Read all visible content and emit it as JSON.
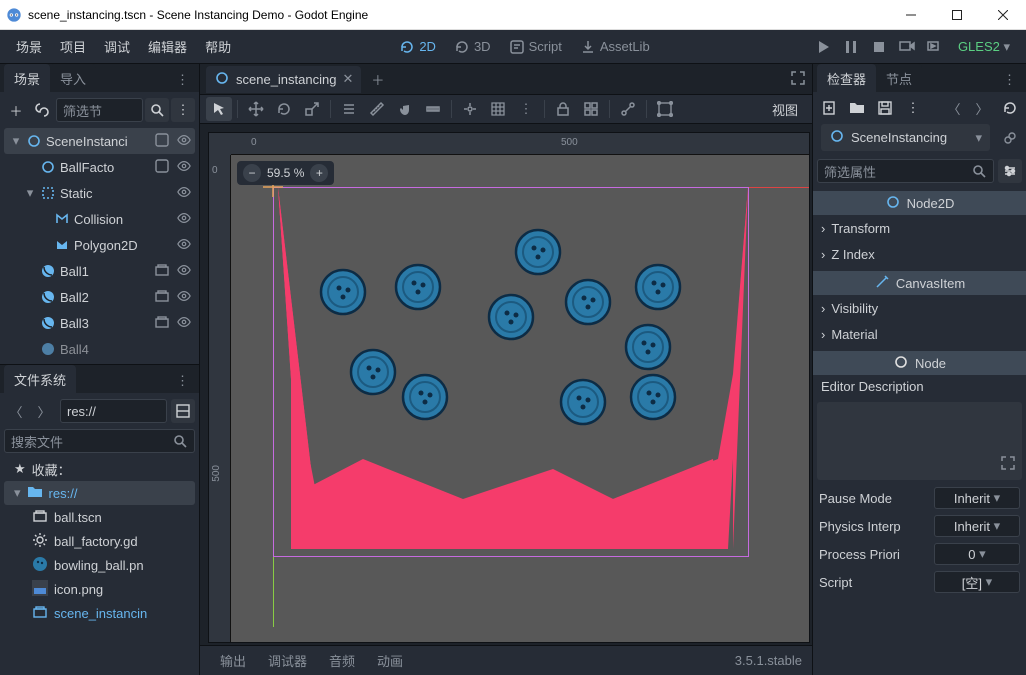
{
  "window": {
    "title": "scene_instancing.tscn - Scene Instancing Demo - Godot Engine"
  },
  "menu": {
    "items": [
      "场景",
      "项目",
      "调试",
      "编辑器",
      "帮助"
    ],
    "workspaces": {
      "ws2d": "2D",
      "ws3d": "3D",
      "script": "Script",
      "assetlib": "AssetLib"
    },
    "renderer": "GLES2"
  },
  "scene_dock": {
    "tabs": {
      "scene": "场景",
      "import": "导入"
    },
    "filter_placeholder": "筛选节",
    "tree": [
      {
        "name": "SceneInstanci",
        "type": "Node2D",
        "depth": 0,
        "expanded": true,
        "selected": true,
        "script": true,
        "vis": true
      },
      {
        "name": "BallFacto",
        "type": "Node2D",
        "depth": 1,
        "script": true,
        "vis": true
      },
      {
        "name": "Static",
        "type": "StaticBody2D",
        "depth": 1,
        "expanded": true,
        "vis": true
      },
      {
        "name": "Collision",
        "type": "CollisionPolygon2D",
        "depth": 2,
        "vis": true
      },
      {
        "name": "Polygon2D",
        "type": "Polygon2D",
        "depth": 2,
        "vis": true
      },
      {
        "name": "Ball1",
        "type": "RigidBody2D",
        "depth": 1,
        "inst": true,
        "vis": true
      },
      {
        "name": "Ball2",
        "type": "RigidBody2D",
        "depth": 1,
        "inst": true,
        "vis": true
      },
      {
        "name": "Ball3",
        "type": "RigidBody2D",
        "depth": 1,
        "inst": true,
        "vis": true
      },
      {
        "name": "Ball4",
        "type": "RigidBody2D",
        "depth": 1,
        "inst": true,
        "vis": true
      }
    ]
  },
  "filesystem": {
    "title": "文件系统",
    "path": "res://",
    "search_placeholder": "搜索文件",
    "fav_label": "收藏：",
    "root": "res://",
    "files": [
      {
        "name": "ball.tscn",
        "icon": "scene"
      },
      {
        "name": "ball_factory.gd",
        "icon": "script"
      },
      {
        "name": "bowling_ball.pn",
        "icon": "image-ball"
      },
      {
        "name": "icon.png",
        "icon": "image"
      },
      {
        "name": "scene_instancin",
        "icon": "scene",
        "highlight": true
      }
    ]
  },
  "scene_tabs": {
    "open": "scene_instancing"
  },
  "canvas_toolbar": {
    "view_label": "视图"
  },
  "viewport": {
    "zoom": "59.5 %",
    "ruler_h": [
      "0",
      "500"
    ],
    "ruler_v": [
      "0",
      "500"
    ]
  },
  "bottom": {
    "tabs": [
      "输出",
      "调试器",
      "音频",
      "动画"
    ],
    "version": "3.5.1.stable"
  },
  "inspector": {
    "tabs": {
      "inspector": "检查器",
      "node": "节点"
    },
    "node_name": "SceneInstancing",
    "filter_placeholder": "筛选属性",
    "class_node2d": "Node2D",
    "fold_transform": "Transform",
    "fold_zindex": "Z Index",
    "class_canvasitem": "CanvasItem",
    "fold_visibility": "Visibility",
    "fold_material": "Material",
    "class_node": "Node",
    "editor_desc_label": "Editor Description",
    "props": {
      "pause_mode": {
        "label": "Pause Mode",
        "value": "Inherit"
      },
      "physics_interp": {
        "label": "Physics Interp",
        "value": "Inherit"
      },
      "process_priority": {
        "label": "Process Priori",
        "value": "0"
      },
      "script": {
        "label": "Script",
        "value": "[空]"
      }
    }
  },
  "colors": {
    "accent": "#67b6ef"
  }
}
